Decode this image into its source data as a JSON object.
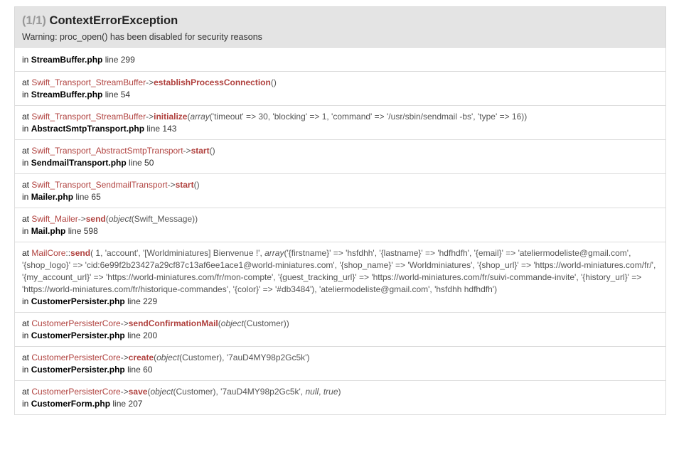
{
  "header": {
    "count": "(1/1)",
    "exception": "ContextErrorException",
    "message": "Warning: proc_open() has been disabled for security reasons"
  },
  "frames": [
    {
      "file": "StreamBuffer.php",
      "line": "line 299"
    },
    {
      "class": "Swift_Transport_StreamBuffer",
      "type": "->",
      "method": "establishProcessConnection",
      "args": "()",
      "file": "StreamBuffer.php",
      "line": "line 54"
    },
    {
      "class": "Swift_Transport_StreamBuffer",
      "type": "->",
      "method": "initialize",
      "args_open": "(",
      "args_kind": "array",
      "args": "('timeout' => 30, 'blocking' => 1, 'command' => '/usr/sbin/sendmail -bs', 'type' => 16))",
      "file": "AbstractSmtpTransport.php",
      "line": "line 143"
    },
    {
      "class": "Swift_Transport_AbstractSmtpTransport",
      "type": "->",
      "method": "start",
      "args": "()",
      "file": "SendmailTransport.php",
      "line": "line 50"
    },
    {
      "class": "Swift_Transport_SendmailTransport",
      "type": "->",
      "method": "start",
      "args": "()",
      "file": "Mailer.php",
      "line": "line 65"
    },
    {
      "class": "Swift_Mailer",
      "type": "->",
      "method": "send",
      "args_open": "(",
      "args_kind": "object",
      "args": "(Swift_Message))",
      "file": "Mail.php",
      "line": "line 598"
    },
    {
      "class": "MailCore",
      "type": "::",
      "method": "send",
      "args_pre": "( 1, 'account', '[Worldminiatures] Bienvenue !', ",
      "args_kind": "array",
      "args": "('{firstname}' => 'hsfdhh', '{lastname}' => 'hdfhdfh', '{email}' => 'ateliermodeliste@gmail.com', '{shop_logo}' => 'cid:6e99f2b23427a29cf87c13af6ee1ace1@world-miniatures.com', '{shop_name}' => 'Worldminiatures', '{shop_url}' => 'https://world-miniatures.com/fr/', '{my_account_url}' => 'https://world-miniatures.com/fr/mon-compte', '{guest_tracking_url}' => 'https://world-miniatures.com/fr/suivi-commande-invite', '{history_url}' => 'https://world-miniatures.com/fr/historique-commandes', '{color}' => '#db3484'), 'ateliermodeliste@gmail.com', 'hsfdhh hdfhdfh')",
      "file": "CustomerPersister.php",
      "line": "line 229"
    },
    {
      "class": "CustomerPersisterCore",
      "type": "->",
      "method": "sendConfirmationMail",
      "args_open": "(",
      "args_kind": "object",
      "args": "(Customer))",
      "file": "CustomerPersister.php",
      "line": "line 200"
    },
    {
      "class": "CustomerPersisterCore",
      "type": "->",
      "method": "create",
      "args_open": "(",
      "args_kind": "object",
      "args": "(Customer), '7auD4MY98p2Gc5k')",
      "file": "CustomerPersister.php",
      "line": "line 60"
    },
    {
      "class": "CustomerPersisterCore",
      "type": "->",
      "method": "save",
      "args_open": "(",
      "args_kind": "object",
      "args": "(Customer), '7auD4MY98p2Gc5k', ",
      "args_null": "null",
      "args_sep": ", ",
      "args_true": "true",
      "args_close": ")",
      "file": "CustomerForm.php",
      "line": "line 207"
    }
  ],
  "labels": {
    "at": "at",
    "in": "in"
  }
}
